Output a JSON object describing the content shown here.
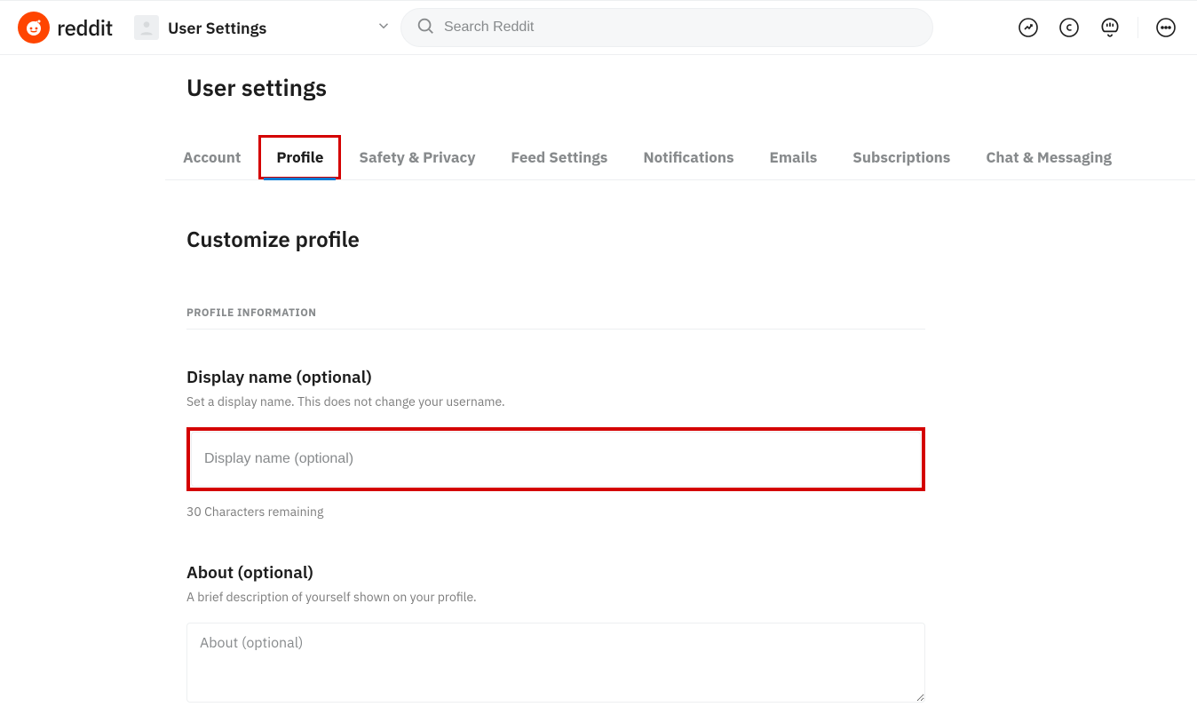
{
  "header": {
    "brand": "reddit",
    "user_dropdown_label": "User Settings",
    "search_placeholder": "Search Reddit"
  },
  "page": {
    "title": "User settings"
  },
  "tabs": [
    {
      "label": "Account",
      "active": false
    },
    {
      "label": "Profile",
      "active": true
    },
    {
      "label": "Safety & Privacy",
      "active": false
    },
    {
      "label": "Feed Settings",
      "active": false
    },
    {
      "label": "Notifications",
      "active": false
    },
    {
      "label": "Emails",
      "active": false
    },
    {
      "label": "Subscriptions",
      "active": false
    },
    {
      "label": "Chat & Messaging",
      "active": false
    }
  ],
  "profile": {
    "section_heading": "Customize profile",
    "subheading": "PROFILE INFORMATION",
    "display_name": {
      "title": "Display name (optional)",
      "help": "Set a display name. This does not change your username.",
      "placeholder": "Display name (optional)",
      "value": "",
      "counter": "30 Characters remaining"
    },
    "about": {
      "title": "About (optional)",
      "help": "A brief description of yourself shown on your profile.",
      "placeholder": "About (optional)",
      "value": ""
    }
  }
}
